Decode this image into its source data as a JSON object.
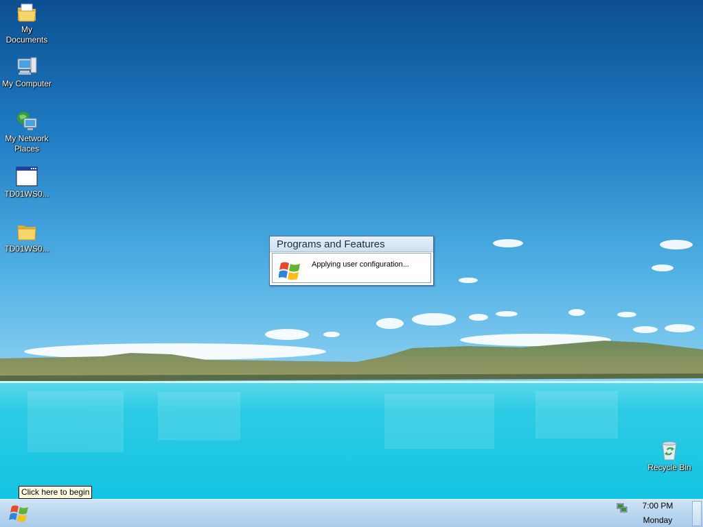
{
  "desktop": {
    "icons": [
      {
        "label_line1": "My",
        "label_line2": "Documents",
        "icon": "documents-folder-icon"
      },
      {
        "label_line1": "My Computer",
        "label_line2": "",
        "icon": "computer-icon"
      },
      {
        "label_line1": "My Network",
        "label_line2": "Places",
        "icon": "network-places-icon"
      },
      {
        "label_line1": "TD01WS0...",
        "label_line2": "",
        "icon": "application-window-icon"
      },
      {
        "label_line1": "TD01WS0...",
        "label_line2": "",
        "icon": "folder-icon"
      }
    ],
    "recycle_bin": {
      "label": "Recycle Bin",
      "icon": "recycle-bin-icon"
    }
  },
  "dialog": {
    "title": "Programs and Features",
    "message": "Applying user configuration...",
    "icon": "windows-logo-icon"
  },
  "tooltip": {
    "text": "Click here to begin"
  },
  "taskbar": {
    "start_icon": "windows-start-icon",
    "tray_icon": "network-status-icon",
    "clock": {
      "time": "7:00 PM",
      "day": "Monday"
    }
  },
  "colors": {
    "sky_top": "#0f5a9e",
    "lake": "#2ed3e8",
    "taskbar": "#bcd8f0"
  }
}
